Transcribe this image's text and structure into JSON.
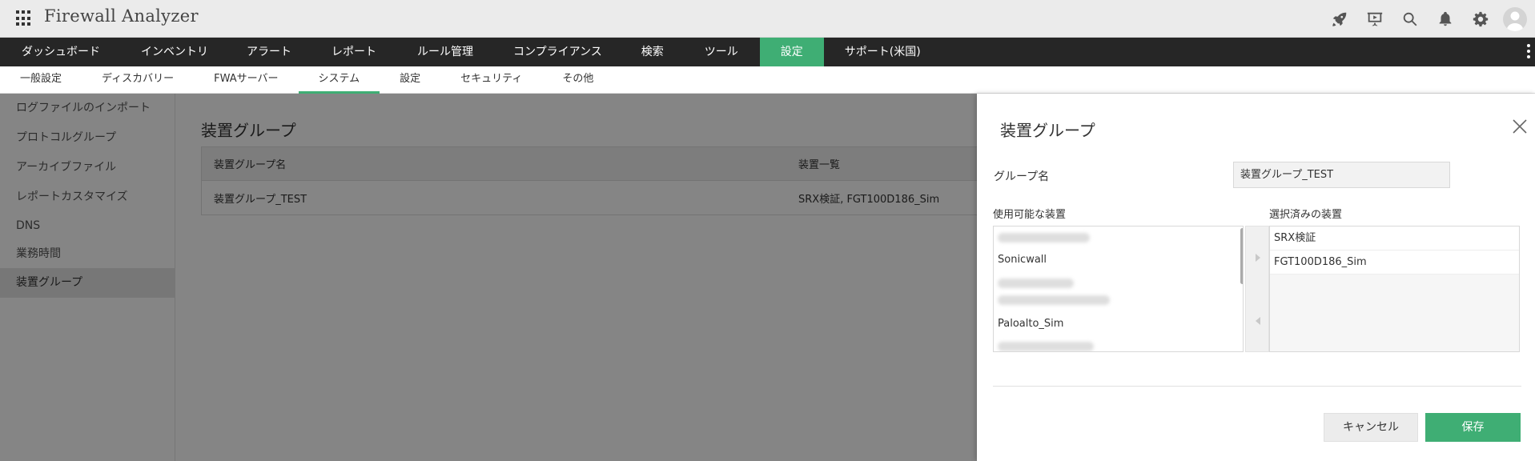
{
  "header": {
    "title": "Firewall Analyzer",
    "icons": [
      "rocket-icon",
      "presentation-icon",
      "search-icon",
      "bell-icon",
      "gear-icon",
      "user-avatar-icon"
    ]
  },
  "main_nav": {
    "items": [
      {
        "label": "ダッシュボード"
      },
      {
        "label": "インベントリ"
      },
      {
        "label": "アラート"
      },
      {
        "label": "レポート"
      },
      {
        "label": "ルール管理"
      },
      {
        "label": "コンプライアンス"
      },
      {
        "label": "検索"
      },
      {
        "label": "ツール"
      },
      {
        "label": "設定",
        "active": true
      },
      {
        "label": "サポート(米国)"
      }
    ],
    "active_color": "#3fae74"
  },
  "sub_nav": {
    "items": [
      {
        "label": "一般設定"
      },
      {
        "label": "ディスカバリー"
      },
      {
        "label": "FWAサーバー"
      },
      {
        "label": "システム",
        "active": true
      },
      {
        "label": "設定"
      },
      {
        "label": "セキュリティ"
      },
      {
        "label": "その他"
      }
    ]
  },
  "sidebar": {
    "items": [
      {
        "label": "ログファイルのインポート"
      },
      {
        "label": "プロトコルグループ"
      },
      {
        "label": "アーカイブファイル"
      },
      {
        "label": "レポートカスタマイズ"
      },
      {
        "label": "DNS"
      },
      {
        "label": "業務時間"
      },
      {
        "label": "装置グループ",
        "active": true
      }
    ]
  },
  "content": {
    "title": "装置グループ",
    "table": {
      "headers": [
        "装置グループ名",
        "装置一覧"
      ],
      "rows": [
        [
          "装置グループ_TEST",
          "SRX検証, FGT100D186_Sim"
        ]
      ]
    }
  },
  "panel": {
    "title": "装置グループ",
    "group_name_label": "グループ名",
    "group_name_value": "装置グループ_TEST",
    "available_label": "使用可能な装置",
    "selected_label": "選択済みの装置",
    "available_devices": [
      "Sonicwall",
      "Paloalto_Sim"
    ],
    "selected_devices": [
      "SRX検証",
      "FGT100D186_Sim"
    ],
    "cancel_label": "キャンセル",
    "save_label": "保存"
  }
}
